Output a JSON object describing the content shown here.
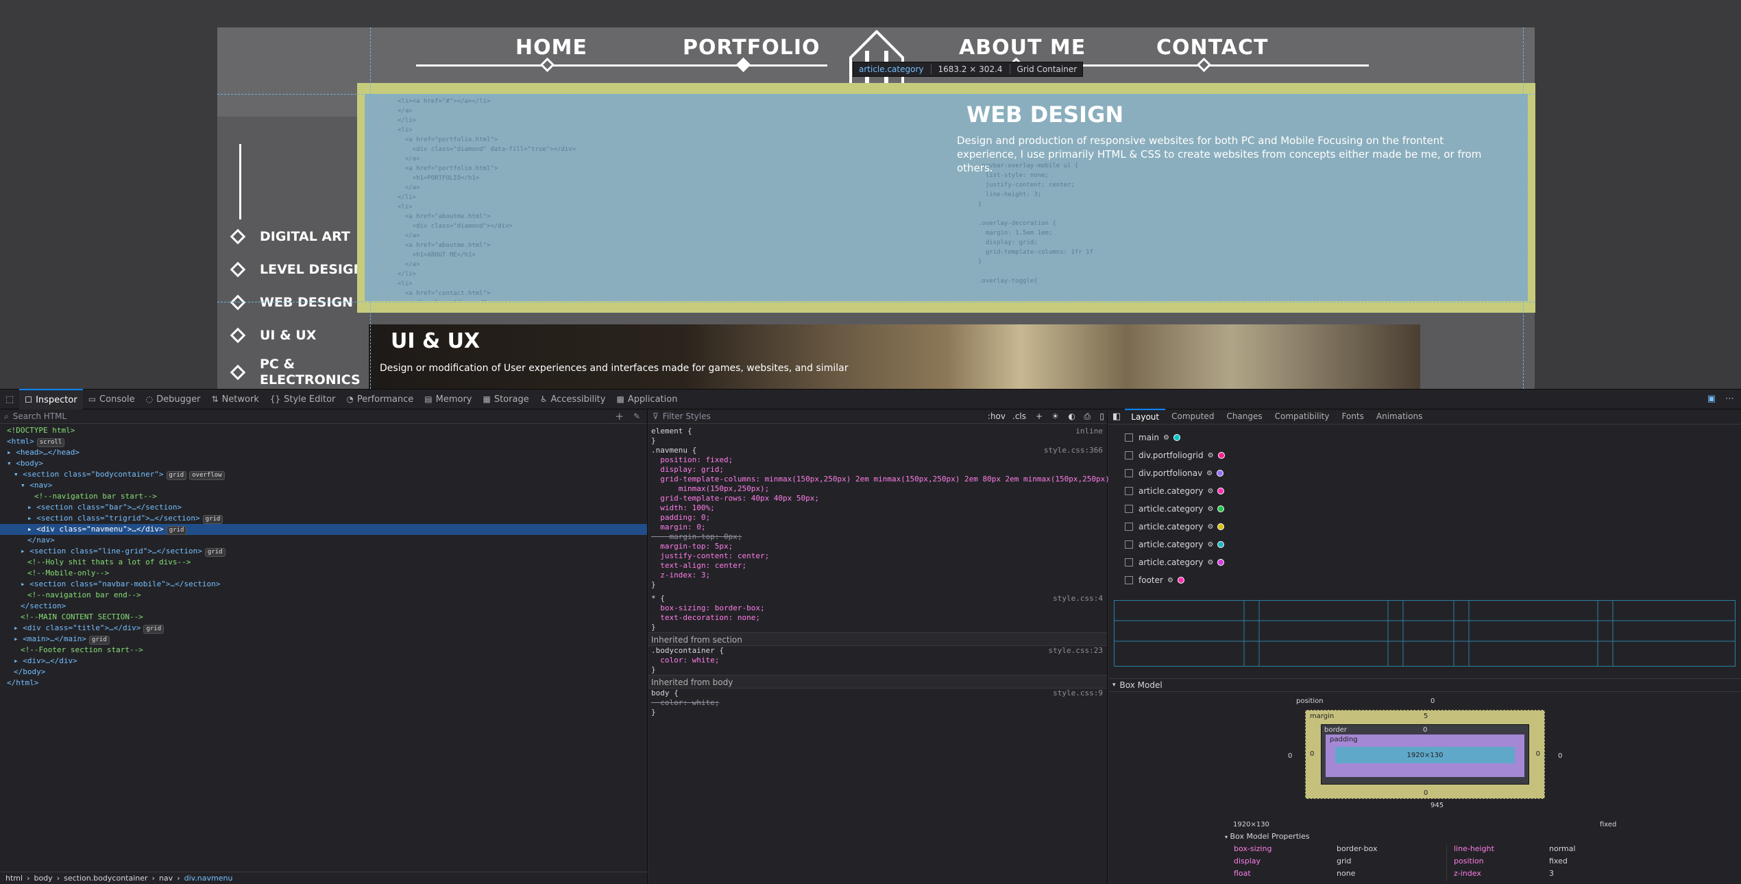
{
  "page": {
    "nav": {
      "home": "HOME",
      "portfolio": "PORTFOLIO",
      "about": "ABOUT ME",
      "contact": "CONTACT"
    },
    "sidebar": [
      {
        "label": "DIGITAL ART"
      },
      {
        "label": "LEVEL DESIGN"
      },
      {
        "label": "WEB DESIGN"
      },
      {
        "label": "UI & UX"
      },
      {
        "label": "PC &\nELECTRONICS"
      }
    ],
    "tooltip": {
      "selector": "article.category",
      "size": "1683.2 × 302.4",
      "type": "Grid Container"
    },
    "web_design": {
      "title": "WEB DESIGN",
      "desc": "Design and production of responsive websites for both PC and Mobile Focusing on the frontent experience, I use primarily HTML & CSS to create websites from concepts either made be me, or from others."
    },
    "ux": {
      "title": "UI & UX",
      "desc": "Design or modification of User experiences and interfaces made for games, websites, and similar"
    },
    "code_left": "<li><a href=\"#\"></a></li>\n</a>\n</li>\n<li>\n  <a href=\"portfolio.html\">\n    <div class=\"diamond\" data-fill=\"true\"></div>\n  </a>\n  <a href=\"portfolio.html\">\n    <h1>PORTFOLIO</h1>\n  </a>\n</li>\n<li>\n  <a href=\"aboutme.html\">\n    <div class=\"diamond\"></div>\n  </a>\n  <a href=\"aboutme.html\">\n    <h1>ABOUT ME</h1>\n  </a>\n</li>\n<li>\n  <a href=\"contact.html\">\n    <div class=\"diamond\">",
    "code_right": ".navbar-overlay-mobile ul {\n  list-style: none;\n  justify-content: center;\n  line-height: 3;\n}\n\n.overlay-decoration {\n  margin: 1.5em 1em;\n  display: grid;\n  grid-template-columns: 1fr 1f\n}\n\n.overlay-toggle{"
  },
  "toolbar": {
    "tabs": [
      {
        "label": "Inspector",
        "icon": "☐"
      },
      {
        "label": "Console",
        "icon": "▭"
      },
      {
        "label": "Debugger",
        "icon": "◌"
      },
      {
        "label": "Network",
        "icon": "⇅"
      },
      {
        "label": "Style Editor",
        "icon": "{}"
      },
      {
        "label": "Performance",
        "icon": "◔"
      },
      {
        "label": "Memory",
        "icon": "▤"
      },
      {
        "label": "Storage",
        "icon": "▦"
      },
      {
        "label": "Accessibility",
        "icon": "♿"
      },
      {
        "label": "Application",
        "icon": "▩"
      }
    ]
  },
  "inspector": {
    "search_placeholder": "Search HTML",
    "tree": [
      {
        "indent": 1,
        "text": "<!DOCTYPE html>",
        "kind": "cm"
      },
      {
        "indent": 1,
        "text": "<html>",
        "kind": "tag",
        "badge": "scroll"
      },
      {
        "indent": 1,
        "text": "▸ <head>…</head>",
        "kind": "tag"
      },
      {
        "indent": 1,
        "text": "▾ <body>",
        "kind": "tag"
      },
      {
        "indent": 2,
        "text": "▾ <section class=\"bodycontainer\">",
        "kind": "tag",
        "badge": "grid overflow"
      },
      {
        "indent": 3,
        "text": "▾ <nav>",
        "kind": "tag"
      },
      {
        "indent": 5,
        "text": "<!--navigation bar start-->",
        "kind": "cm"
      },
      {
        "indent": 4,
        "text": "▸ <section class=\"bar\">…</section>",
        "kind": "tag"
      },
      {
        "indent": 4,
        "text": "▸ <section class=\"trigrid\">…</section>",
        "kind": "tag",
        "badge": "grid"
      },
      {
        "indent": 4,
        "text": "▸ <div class=\"navmenu\">…</div>",
        "kind": "tag",
        "badge": "grid",
        "sel": true
      },
      {
        "indent": 4,
        "text": "</nav>",
        "kind": "tag"
      },
      {
        "indent": 3,
        "text": "▸ <section class=\"line-grid\">…</section>",
        "kind": "tag",
        "badge": "grid"
      },
      {
        "indent": 4,
        "text": "<!--Holy shit thats a lot of divs-->",
        "kind": "cm"
      },
      {
        "indent": 4,
        "text": "<!--Mobile-only-->",
        "kind": "cm"
      },
      {
        "indent": 3,
        "text": "▸ <section class=\"navbar-mobile\">…</section>",
        "kind": "tag"
      },
      {
        "indent": 4,
        "text": "<!--navigation bar end-->",
        "kind": "cm"
      },
      {
        "indent": 3,
        "text": "</section>",
        "kind": "tag"
      },
      {
        "indent": 3,
        "text": "<!--MAIN CONTENT SECTION-->",
        "kind": "cm"
      },
      {
        "indent": 2,
        "text": "▸ <div class=\"title\">…</div>",
        "kind": "tag",
        "badge": "grid"
      },
      {
        "indent": 2,
        "text": "▸ <main>…</main>",
        "kind": "tag",
        "badge": "grid"
      },
      {
        "indent": 3,
        "text": "<!--Footer section start-->",
        "kind": "cm"
      },
      {
        "indent": 2,
        "text": "▸ <div>…</div>",
        "kind": "tag"
      },
      {
        "indent": 2,
        "text": "</body>",
        "kind": "tag"
      },
      {
        "indent": 1,
        "text": "</html>",
        "kind": "tag"
      }
    ],
    "breadcrumb": [
      "html",
      "body",
      "section.bodycontainer",
      "nav",
      "div.navmenu"
    ]
  },
  "rules": {
    "filter_placeholder": "Filter Styles",
    "hov": ":hov",
    "cls": ".cls",
    "lines": [
      {
        "t": "element {",
        "src": "inline"
      },
      {
        "t": "}"
      },
      {
        "t": ".navmenu {",
        "src": "style.css:366"
      },
      {
        "t": "  position: fixed;"
      },
      {
        "t": "  display: grid;"
      },
      {
        "t": "  grid-template-columns: minmax(150px,250px) 2em minmax(150px,250px) 2em 80px 2em minmax(150px,250px) 2em"
      },
      {
        "t": "      minmax(150px,250px);"
      },
      {
        "t": "  grid-template-rows: 40px 40px 50px;"
      },
      {
        "t": "  width: 100%;"
      },
      {
        "t": "  padding: 0;"
      },
      {
        "t": "  margin: 0;"
      },
      {
        "t": "    margin-top: 0px;"
      },
      {
        "t": "  margin-top: 5px;"
      },
      {
        "t": "  justify-content: center;"
      },
      {
        "t": "  text-align: center;"
      },
      {
        "t": "  z-index: 3;"
      },
      {
        "t": "}"
      }
    ],
    "lines2": [
      {
        "t": "* {",
        "src": "style.css:4"
      },
      {
        "t": "  box-sizing: border-box;"
      },
      {
        "t": "  text-decoration: none;"
      },
      {
        "t": "}"
      }
    ],
    "inherited1": "Inherited from section",
    "lines3": [
      {
        "t": ".bodycontainer {",
        "src": "style.css:23"
      },
      {
        "t": "  color: white;"
      },
      {
        "t": "}"
      }
    ],
    "inherited2": "Inherited from body",
    "lines4": [
      {
        "t": "body {",
        "src": "style.css:9"
      },
      {
        "t": "  color: white;"
      },
      {
        "t": "}"
      }
    ]
  },
  "layout": {
    "tabs": [
      "Layout",
      "Computed",
      "Changes",
      "Compatibility",
      "Fonts",
      "Animations"
    ],
    "grids": [
      {
        "label": "main",
        "color": "#00c7c7"
      },
      {
        "label": "div.portfoliogrid",
        "color": "#ff1f8c"
      },
      {
        "label": "div.portfolionav",
        "color": "#9a6bff"
      },
      {
        "label": "article.category",
        "color": "#ff2fb0"
      },
      {
        "label": "article.category",
        "color": "#21c44e"
      },
      {
        "label": "article.category",
        "color": "#d6c10f"
      },
      {
        "label": "article.category",
        "color": "#21b6c4"
      },
      {
        "label": "article.category",
        "color": "#d33de3"
      },
      {
        "label": "footer",
        "color": "#ff2fb0"
      }
    ],
    "box_model_title": "Box Model",
    "box": {
      "position_label": "position",
      "margin_label": "margin",
      "border_label": "border",
      "padding_label": "padding",
      "content": "1920×130",
      "zero": "0",
      "five": "5",
      "bottom": "945"
    },
    "dims": "1920×130",
    "pos": "fixed",
    "props_title": "Box Model Properties",
    "props": [
      {
        "k": "box-sizing",
        "v": "border-box",
        "k2": "line-height",
        "v2": "normal"
      },
      {
        "k": "display",
        "v": "grid",
        "k2": "position",
        "v2": "fixed"
      },
      {
        "k": "float",
        "v": "none",
        "k2": "z-index",
        "v2": "3"
      }
    ]
  }
}
